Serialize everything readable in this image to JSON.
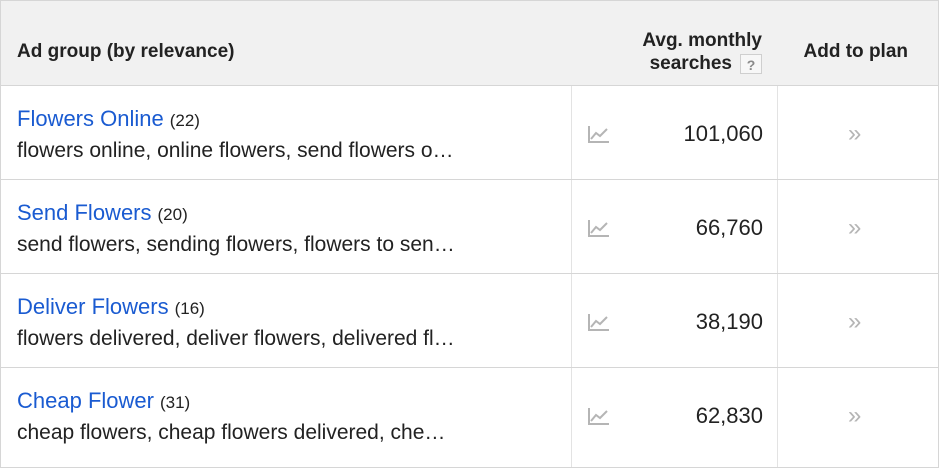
{
  "header": {
    "ad_group_label": "Ad group (by relevance)",
    "avg_line1": "Avg. monthly",
    "avg_line2": "searches",
    "help_glyph": "?",
    "add_to_plan": "Add to plan"
  },
  "rows": [
    {
      "name": "Flowers Online",
      "count": "(22)",
      "keywords": "flowers online, online flowers, send flowers o…",
      "searches": "101,060",
      "add_glyph": "»"
    },
    {
      "name": "Send Flowers",
      "count": "(20)",
      "keywords": "send flowers, sending flowers, flowers to sen…",
      "searches": "66,760",
      "add_glyph": "»"
    },
    {
      "name": "Deliver Flowers",
      "count": "(16)",
      "keywords": "flowers delivered, deliver flowers, delivered fl…",
      "searches": "38,190",
      "add_glyph": "»"
    },
    {
      "name": "Cheap Flower",
      "count": "(31)",
      "keywords": "cheap flowers, cheap flowers delivered, che…",
      "searches": "62,830",
      "add_glyph": "»"
    }
  ],
  "colors": {
    "link": "#1a5bd1",
    "header_bg": "#f1f1f1",
    "icon_gray": "#b5b5b5"
  },
  "icons": {
    "chart": "trend-chart-icon",
    "add": "double-chevron-right-icon",
    "help": "help-question-icon"
  }
}
